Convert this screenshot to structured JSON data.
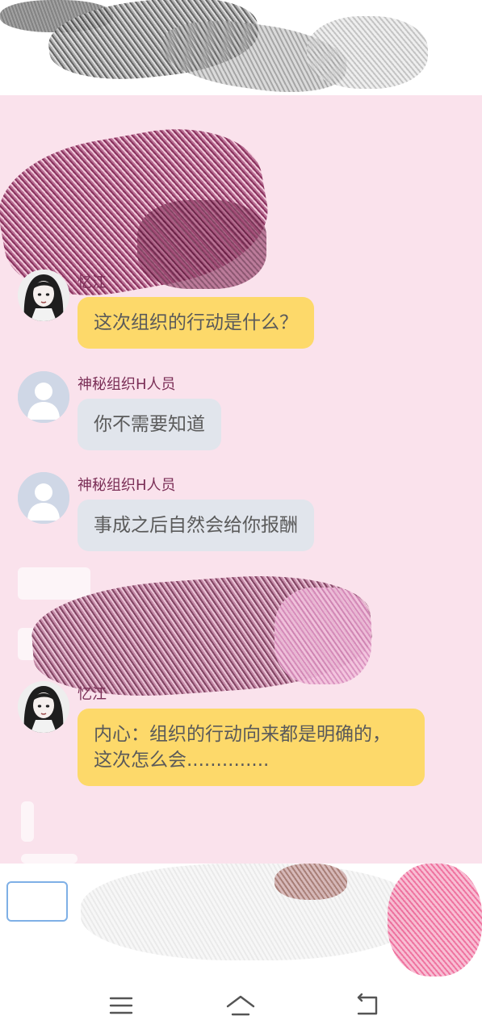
{
  "messages": [
    {
      "sender": "忆江",
      "text": "这次组织的行动是什么？",
      "side": "left",
      "bubble_color": "#fdd96a",
      "avatar": "girl-avatar"
    },
    {
      "sender": "神秘组织H人员",
      "text": "你不需要知道",
      "side": "left",
      "bubble_color": "#e1e5ec",
      "avatar": "default-user-avatar"
    },
    {
      "sender": "神秘组织H人员",
      "text": "事成之后自然会给你报酬",
      "side": "left",
      "bubble_color": "#e1e5ec",
      "avatar": "default-user-avatar"
    },
    {
      "sender": "忆江",
      "text": "内心：组织的行动向来都是明确的，这次怎么会..............",
      "side": "left",
      "bubble_color": "#fdd96a",
      "avatar": "girl-avatar"
    }
  ],
  "colors": {
    "chat_background": "#fae2ec",
    "sender_name": "#7b2f57",
    "yellow_bubble": "#fdd96a",
    "grey_bubble": "#e1e5ec"
  },
  "nav": {
    "menu_icon": "menu-icon",
    "home_icon": "home-icon",
    "back_icon": "back-icon"
  }
}
